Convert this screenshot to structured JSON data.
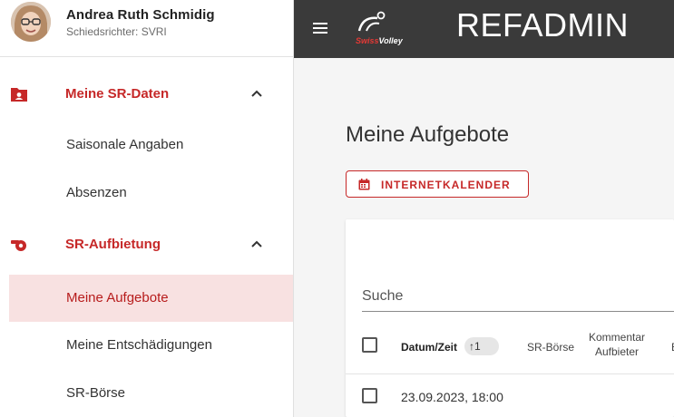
{
  "user": {
    "name": "Andrea Ruth Schmidig",
    "role": "Schiedsrichter: SVRI"
  },
  "sidebar": {
    "groups": [
      {
        "label": "Meine SR-Daten",
        "icon": "person-folder-icon",
        "expanded": true,
        "items": [
          {
            "label": "Saisonale Angaben"
          },
          {
            "label": "Absenzen"
          }
        ]
      },
      {
        "label": "SR-Aufbietung",
        "icon": "whistle-icon",
        "expanded": true,
        "items": [
          {
            "label": "Meine Aufgebote",
            "active": true
          },
          {
            "label": "Meine Entschädigungen"
          },
          {
            "label": "SR-Börse"
          }
        ]
      }
    ]
  },
  "topbar": {
    "menu_icon": "hamburger-menu-icon",
    "logo_text": {
      "swiss": "Swiss",
      "volley": "Volley"
    },
    "title": "REFADMIN"
  },
  "main": {
    "title": "Meine Aufgebote",
    "calendar_button": "INTERNETKALENDER",
    "search": {
      "placeholder": "Suche",
      "value": ""
    },
    "table": {
      "columns": [
        {
          "label": "Datum/Zeit",
          "sort_badge": "↑1"
        },
        {
          "label": "SR-Börse"
        },
        {
          "label_line1": "Kommentar",
          "label_line2": "Aufbieter"
        },
        {
          "label": "E"
        }
      ],
      "rows": [
        {
          "datetime": "23.09.2023, 18:00"
        }
      ]
    }
  },
  "colors": {
    "accent": "#c62828",
    "active_bg": "#f8e1e1",
    "topbar_bg": "#3a3a3a",
    "main_bg": "#f5f5f5"
  }
}
